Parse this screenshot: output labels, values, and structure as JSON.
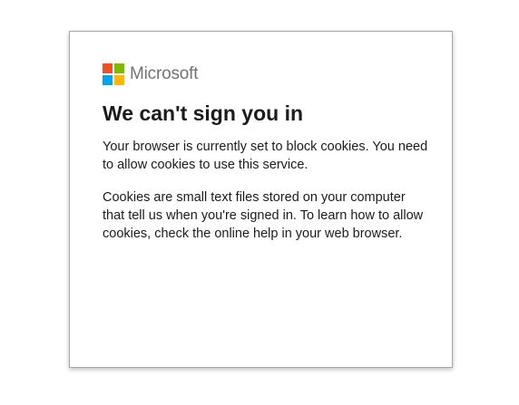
{
  "logo": {
    "text": "Microsoft",
    "colors": [
      "#f25022",
      "#7fba00",
      "#00a4ef",
      "#ffb900"
    ]
  },
  "error": {
    "title": "We can't sign you in",
    "paragraphs": [
      "Your browser is currently set to block cookies. You need to allow cookies to use this service.",
      "Cookies are small text files stored on your computer that tell us when you're signed in. To learn how to allow cookies, check the online help in your web browser."
    ]
  }
}
